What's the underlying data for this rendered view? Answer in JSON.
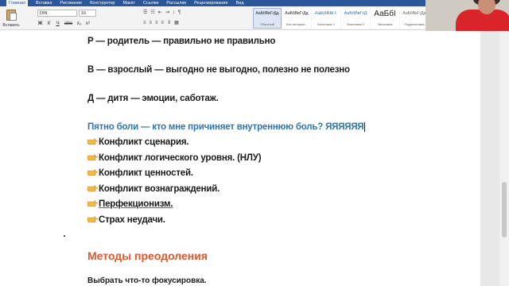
{
  "ribbon": {
    "tabs": [
      "Главная",
      "Вставка",
      "Рисование",
      "Конструктор",
      "Макет",
      "Ссылки",
      "Рассылки",
      "Рецензирование",
      "Вид"
    ],
    "paste_label": "Вставить",
    "font_name": "DIN",
    "font_size": "16",
    "format_buttons": [
      "Ж",
      "К",
      "Ч",
      "abc",
      "x₂",
      "x²"
    ],
    "para_row1": [
      "☰",
      "☷",
      "⇤",
      "⇥",
      "↕",
      "¶"
    ],
    "para_row2": [
      "≡",
      "≡",
      "≡",
      "≡",
      "⇕",
      "▦"
    ],
    "styles": [
      {
        "preview": "АаБбВвГгДд",
        "name": "Обычный"
      },
      {
        "preview": "АаБбВвГгДд",
        "name": "Без интерва..."
      },
      {
        "preview": "АаБбВвГг.",
        "name": "Заголовок 1"
      },
      {
        "preview": "АаБбВвГгД",
        "name": "Заголовок 2"
      },
      {
        "preview": "АаБбI",
        "name": "Заголовок"
      },
      {
        "preview": "АаБбВвГгДд",
        "name": "Подзаголовок"
      }
    ]
  },
  "document": {
    "line_p": "Р — родитель — правильно не правильно",
    "line_v": "В — взрослый — выгодно не выгодно, полезно не полезно",
    "line_d": "Д — дитя — эмоции, саботаж.",
    "pain_question": "Пятно боли — кто мне причиняет внутреннюю боль? ЯЯЯЯЯЯ",
    "conflicts": [
      "Конфликт сценария.",
      "Конфликт логического уровня. (НЛУ)",
      "Конфликт ценностей.",
      "Конфликт вознаграждений.",
      "Перфекционизм.",
      "Страх неудачи."
    ],
    "methods_heading": "Методы преодоления",
    "choose_line": "Выбрать что-то фокусировка."
  },
  "colors": {
    "ribbon_blue": "#2b579a",
    "heading_orange": "#e0572e",
    "text_blue": "#2e74b5"
  }
}
